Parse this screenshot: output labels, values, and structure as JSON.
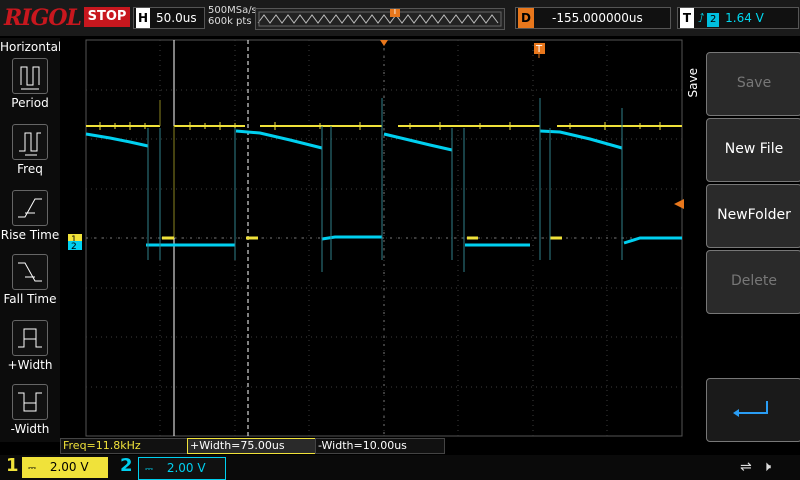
{
  "header": {
    "logo": "RIGOL",
    "run_state": "STOP",
    "timebase_label": "H",
    "timebase_value": "50.0us",
    "sample_rate": "500MSa/s",
    "memory_depth": "600k pts",
    "trigger_marker": "T",
    "delay_label": "D",
    "delay_value": "-155.000000us",
    "trigger_label": "T",
    "trigger_source": "2",
    "trigger_level": "1.64 V",
    "trigger_edge_icon": "rising-edge-icon"
  },
  "left_menu": {
    "title": "Horizontal",
    "items": [
      {
        "label": "Period",
        "icon": "period-icon"
      },
      {
        "label": "Freq",
        "icon": "freq-icon"
      },
      {
        "label": "Rise Time",
        "icon": "rise-time-icon"
      },
      {
        "label": "Fall Time",
        "icon": "fall-time-icon"
      },
      {
        "label": "+Width",
        "icon": "pos-width-icon"
      },
      {
        "label": "-Width",
        "icon": "neg-width-icon"
      }
    ]
  },
  "right_menu": {
    "title": "Save",
    "buttons": [
      {
        "label": "Save",
        "enabled": false
      },
      {
        "label": "New File",
        "enabled": true
      },
      {
        "label": "NewFolder",
        "enabled": true
      },
      {
        "label": "Delete",
        "enabled": false
      }
    ],
    "back_icon": "return-arrow-icon"
  },
  "measurements": {
    "freq": "Freq=11.8kHz",
    "pos_width": "+Width=75.00us",
    "neg_width": "-Width=10.00us"
  },
  "channels": [
    {
      "number": "1",
      "coupling_icon": "dc-coupling-icon",
      "scale": "2.00 V",
      "color": "#f0e23a"
    },
    {
      "number": "2",
      "coupling_icon": "dc-coupling-icon",
      "scale": "2.00 V",
      "color": "#00d0f0"
    }
  ],
  "status_icons": [
    "usb-icon",
    "speaker-icon"
  ],
  "colors": {
    "ch1": "#f0e23a",
    "ch2": "#00d0f0",
    "trigger": "#e8771c",
    "stop": "#c8171e"
  },
  "screen": {
    "ch1_marker": "1",
    "ch2_marker": "2",
    "trig_pos_marker": "T"
  }
}
